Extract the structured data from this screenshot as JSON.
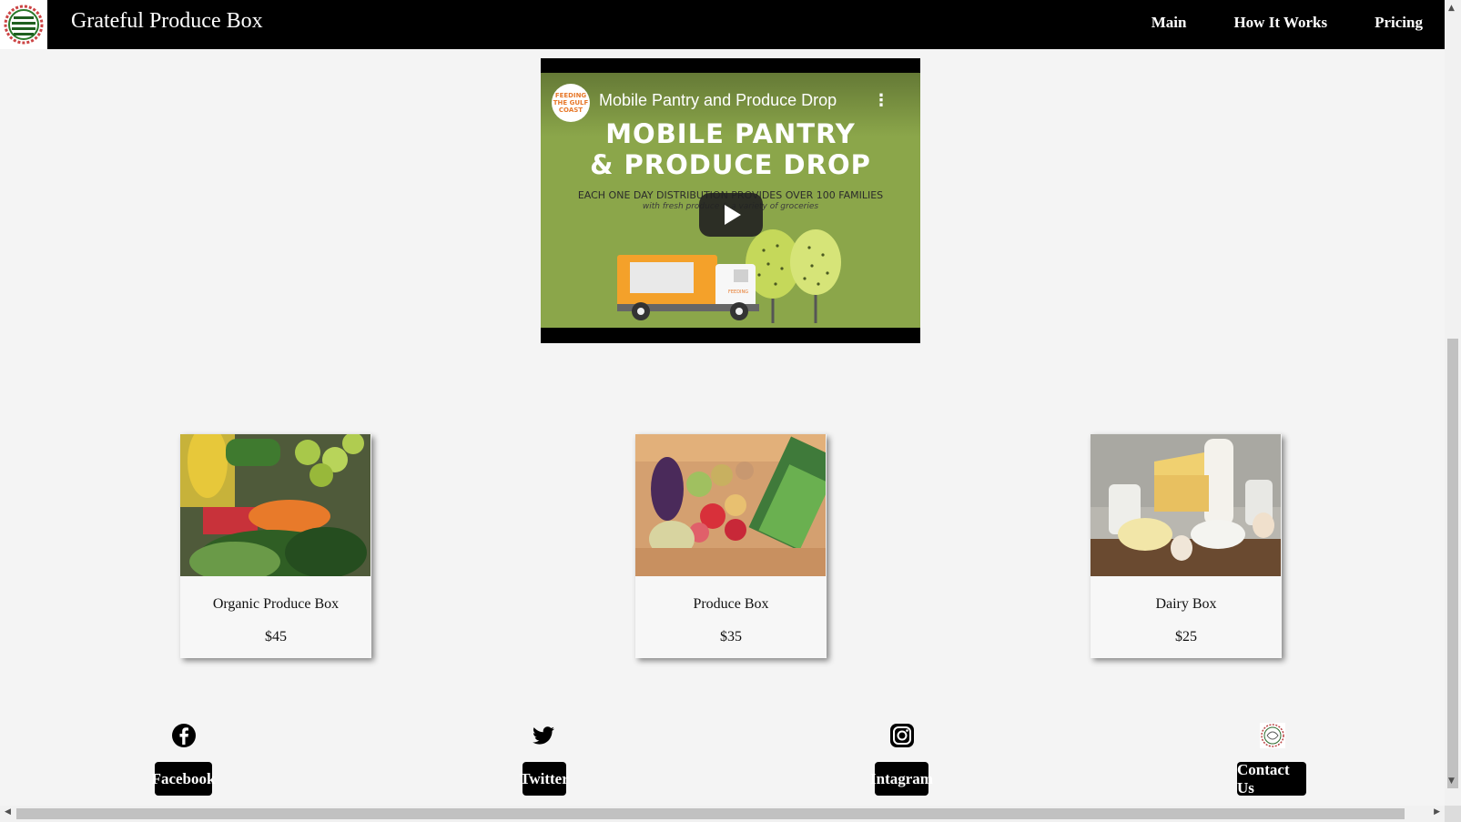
{
  "header": {
    "title": "Grateful Produce Box",
    "nav": [
      "Main",
      "How It Works",
      "Pricing"
    ]
  },
  "video": {
    "channel_avatar_text": "FEEDING THE GULF COAST",
    "title": "Mobile Pantry and Produce Drop",
    "headline_line1": "MOBILE PANTRY",
    "headline_line2": "& PRODUCE DROP",
    "subline": "EACH ONE DAY DISTRIBUTION PROVIDES OVER 100 FAMILIES",
    "subline2": "with fresh produce & a variety of groceries",
    "truck_label": "FEEDING"
  },
  "products": [
    {
      "name": "Organic Produce Box",
      "price": "$45"
    },
    {
      "name": "Produce Box",
      "price": "$35"
    },
    {
      "name": "Dairy Box",
      "price": "$25"
    }
  ],
  "social": {
    "facebook": "Facebook",
    "twitter": "Twitter",
    "instagram": "Intagram",
    "contact": "Contact Us"
  },
  "colors": {
    "header_bg": "#000000",
    "page_bg": "#f4f4f4",
    "video_green": "#8ba64a",
    "button_bg": "#000000"
  }
}
